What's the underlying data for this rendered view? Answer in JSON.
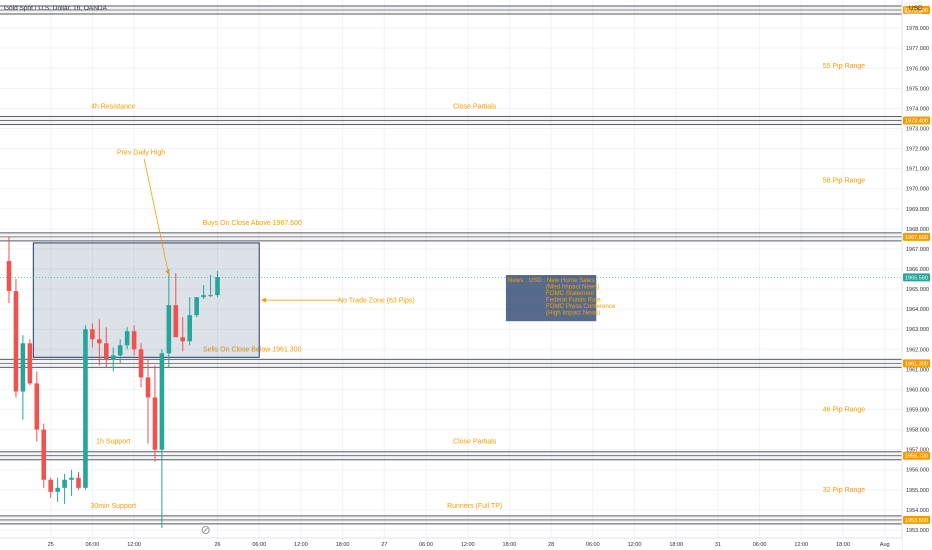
{
  "symbol_title": "Gold Spot / U.S. Dollar, 1h, OANDA",
  "currency": "USD",
  "colors": {
    "up": "#26a69a",
    "down": "#ef5350",
    "level_label": "#f59d00",
    "text": "#2a2e39",
    "grid": "#f0f3fa",
    "zone_fill": "#1e3a66",
    "news_fill": "#1e3a66",
    "band": "#5d606b"
  },
  "chart_data": {
    "type": "candlestick",
    "y_ticks": [
      "1953.000",
      "1954.000",
      "1955.000",
      "1956.000",
      "1957.000",
      "1958.000",
      "1959.000",
      "1960.000",
      "1961.000",
      "1962.000",
      "1963.000",
      "1964.000",
      "1965.000",
      "1966.000",
      "1967.000",
      "1968.000",
      "1969.000",
      "1970.000",
      "1971.000",
      "1972.000",
      "1973.000",
      "1974.000",
      "1975.000",
      "1976.000",
      "1977.000",
      "1978.000"
    ],
    "ylim": [
      1952.6,
      1979.4
    ],
    "x_ticks": [
      {
        "label": "25",
        "t": 6
      },
      {
        "label": "06:00",
        "t": 12
      },
      {
        "label": "12:00",
        "t": 18
      },
      {
        "label": "26",
        "t": 30
      },
      {
        "label": "06:00",
        "t": 36
      },
      {
        "label": "12:00",
        "t": 42
      },
      {
        "label": "18:00",
        "t": 48
      },
      {
        "label": "27",
        "t": 54
      },
      {
        "label": "06:00",
        "t": 60
      },
      {
        "label": "12:00",
        "t": 66
      },
      {
        "label": "18:00",
        "t": 72
      },
      {
        "label": "28",
        "t": 78
      },
      {
        "label": "06:00",
        "t": 84
      },
      {
        "label": "12:00",
        "t": 90
      },
      {
        "label": "18:00",
        "t": 96
      },
      {
        "label": "31",
        "t": 102
      },
      {
        "label": "06:00",
        "t": 108
      },
      {
        "label": "12:00",
        "t": 114
      },
      {
        "label": "18:00",
        "t": 120
      },
      {
        "label": "Aug",
        "t": 126
      }
    ],
    "candles": [
      [
        1966.4,
        1967.6,
        1964.3,
        1964.9
      ],
      [
        1964.9,
        1965.5,
        1959.6,
        1959.9
      ],
      [
        1959.9,
        1962.7,
        1958.5,
        1962.3
      ],
      [
        1962.3,
        1962.5,
        1960.2,
        1960.3
      ],
      [
        1960.3,
        1960.9,
        1957.4,
        1958.0
      ],
      [
        1958.0,
        1958.3,
        1955.1,
        1955.5
      ],
      [
        1955.5,
        1955.6,
        1954.6,
        1954.9
      ],
      [
        1954.9,
        1955.6,
        1954.4,
        1955.1
      ],
      [
        1955.1,
        1955.8,
        1954.3,
        1955.5
      ],
      [
        1955.5,
        1956.0,
        1954.7,
        1955.6
      ],
      [
        1955.6,
        1955.9,
        1955.0,
        1955.1
      ],
      [
        1955.1,
        1963.2,
        1955.0,
        1963.0
      ],
      [
        1963.0,
        1963.3,
        1962.1,
        1962.5
      ],
      [
        1962.5,
        1963.5,
        1961.2,
        1962.3
      ],
      [
        1962.3,
        1963.1,
        1961.1,
        1961.5
      ],
      [
        1961.5,
        1962.1,
        1960.9,
        1961.7
      ],
      [
        1961.7,
        1962.5,
        1961.3,
        1962.2
      ],
      [
        1962.2,
        1963.1,
        1962.0,
        1962.9
      ],
      [
        1962.9,
        1963.2,
        1961.7,
        1962.0
      ],
      [
        1962.0,
        1962.3,
        1960.1,
        1960.6
      ],
      [
        1960.6,
        1961.5,
        1957.3,
        1959.6
      ],
      [
        1959.6,
        1961.2,
        1956.4,
        1957.0
      ],
      [
        1957.0,
        1962.0,
        1953.1,
        1961.8
      ],
      [
        1961.8,
        1966.0,
        1961.1,
        1964.2
      ],
      [
        1964.2,
        1965.8,
        1962.7,
        1962.6
      ],
      [
        1962.6,
        1963.6,
        1961.9,
        1962.4
      ],
      [
        1962.4,
        1964.6,
        1962.2,
        1963.7
      ],
      [
        1963.7,
        1964.5,
        1963.6,
        1964.6
      ],
      [
        1964.6,
        1965.2,
        1964.5,
        1964.7
      ],
      [
        1964.7,
        1965.7,
        1964.6,
        1964.7
      ],
      [
        1964.7,
        1965.9,
        1964.6,
        1965.6
      ]
    ],
    "current_price": "1965.580",
    "levels": [
      {
        "value": 1978.9,
        "price_label": "1978.900",
        "labels": [
          {
            "text": "Daily Resistance",
            "t": 15
          },
          {
            "text": "Runners (Full TP)",
            "t": 67
          }
        ]
      },
      {
        "value": 1973.4,
        "price_label": "1973.400",
        "labels": [
          {
            "text": "4h Resistance",
            "t": 15
          },
          {
            "text": "Close Partials",
            "t": 67
          }
        ]
      },
      {
        "value": 1967.6,
        "price_label": "1967.600",
        "labels": [
          {
            "text": "Buys On Close Above 1967.600",
            "t": 35
          }
        ]
      },
      {
        "value": 1961.3,
        "price_label": "1961.300",
        "labels": [
          {
            "text": "Sells On Close Below 1961.300",
            "t": 35
          }
        ]
      },
      {
        "value": 1956.7,
        "price_label": "1956.700",
        "labels": [
          {
            "text": "1h Support",
            "t": 15
          },
          {
            "text": "Close Partials",
            "t": 67
          }
        ]
      },
      {
        "value": 1953.5,
        "price_label": "1953.500",
        "labels": [
          {
            "text": "30min Support",
            "t": 15
          },
          {
            "text": "Runners (Full TP)",
            "t": 67
          }
        ]
      }
    ],
    "range_labels": [
      {
        "text": "55 Pip Range",
        "value": 1976.1
      },
      {
        "text": "58 Pip Range",
        "value": 1970.4
      },
      {
        "text": "46 Pip Range",
        "value": 1959.0
      },
      {
        "text": "32 Pip Range",
        "value": 1955.0
      }
    ],
    "no_trade_zone": {
      "t0": 3.5,
      "t1": 36,
      "top": 1967.3,
      "bottom": 1961.6,
      "label": "No Trade Zone (63 Pips)",
      "label_t": 52
    },
    "prev_daily_high": {
      "label": "Prev Daily High",
      "label_t": 19,
      "label_value": 1971.7,
      "arrow_t": 23,
      "arrow_value": 1965.7
    },
    "news": {
      "t0": 71.5,
      "t1": 84.5,
      "top": 1965.7,
      "bottom": 1963.4,
      "lines": [
        "News : USD : New Home Sales",
        "(Med Impact News)",
        "FOMC Statement",
        "Federal Funds Rate",
        "FOMC Press Conference",
        "(High Impact News)"
      ]
    },
    "session_marker_t": 28
  }
}
